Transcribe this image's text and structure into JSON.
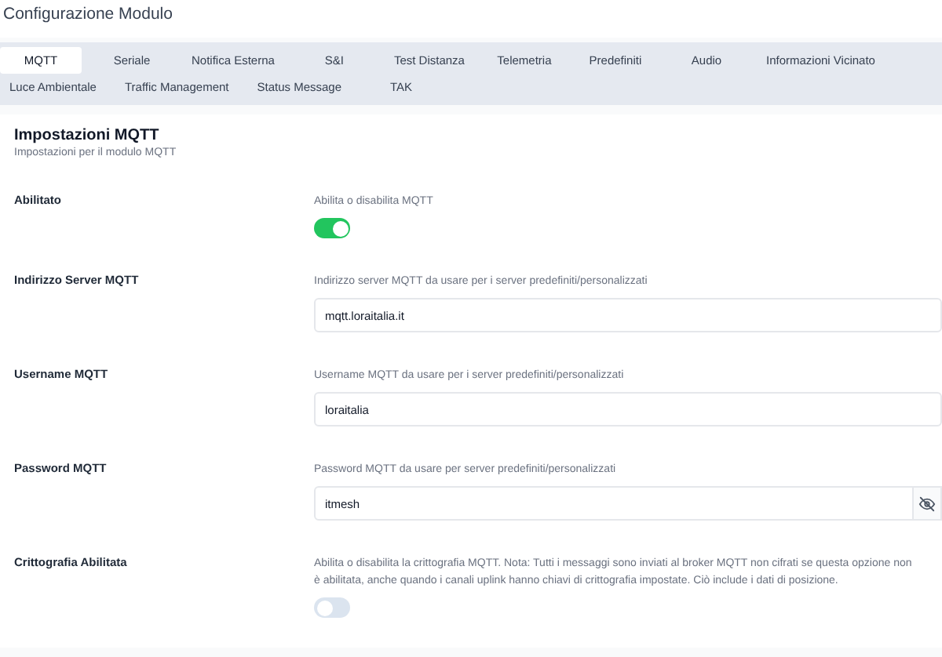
{
  "title": "Configurazione Modulo",
  "tabs": [
    {
      "label": "MQTT",
      "selected": true
    },
    {
      "label": "Seriale",
      "selected": false
    },
    {
      "label": "Notifica Esterna",
      "selected": false
    },
    {
      "label": "S&I",
      "selected": false
    },
    {
      "label": "Test Distanza",
      "selected": false
    },
    {
      "label": "Telemetria",
      "selected": false
    },
    {
      "label": "Predefiniti",
      "selected": false
    },
    {
      "label": "Audio",
      "selected": false
    },
    {
      "label": "Informazioni Vicinato",
      "selected": false
    },
    {
      "label": "Luce Ambientale",
      "selected": false
    },
    {
      "label": "Traffic Management",
      "selected": false
    },
    {
      "label": "Status Message",
      "selected": false
    },
    {
      "label": "TAK",
      "selected": false
    }
  ],
  "section": {
    "title": "Impostazioni MQTT",
    "subtitle": "Impostazioni per il modulo MQTT"
  },
  "settings": [
    {
      "kind": "toggle",
      "label": "Abilitato",
      "description": "Abilita o disabilita MQTT",
      "on": true
    },
    {
      "kind": "text",
      "label": "Indirizzo Server MQTT",
      "description": "Indirizzo server MQTT da usare per i server predefiniti/personalizzati",
      "value": "mqtt.loraitalia.it"
    },
    {
      "kind": "text",
      "label": "Username MQTT",
      "description": "Username MQTT da usare per i server predefiniti/personalizzati",
      "value": "loraitalia"
    },
    {
      "kind": "password",
      "label": "Password MQTT",
      "description": "Password MQTT da usare per server predefiniti/personalizzati",
      "value": "itmesh"
    },
    {
      "kind": "toggle",
      "label": "Crittografia Abilitata",
      "description": "Abilita o disabilita la crittografia MQTT. Nota: Tutti i messaggi sono inviati al broker MQTT non cifrati se questa opzione non è abilitata, anche quando i canali uplink hanno chiavi di crittografia impostate. Ciò include i dati di posizione.",
      "on": false
    }
  ]
}
